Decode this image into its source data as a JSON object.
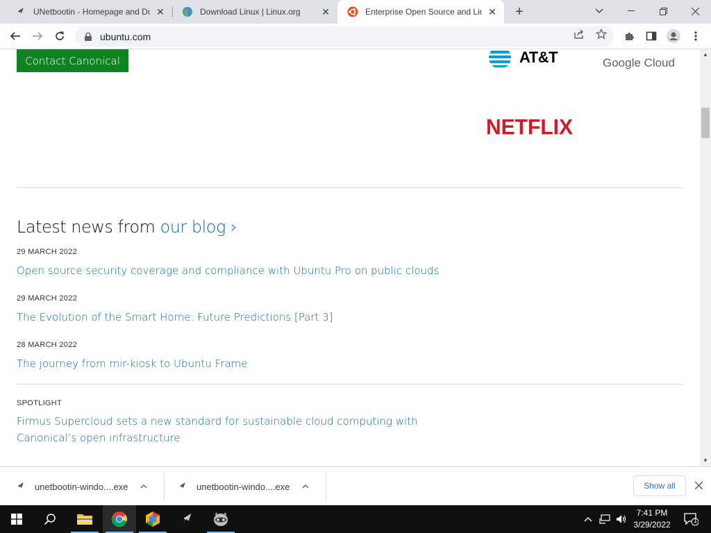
{
  "browser": {
    "tabs": [
      {
        "title": "UNetbootin - Homepage and Do",
        "favicon": "unetbootin-icon",
        "active": false
      },
      {
        "title": "Download Linux | Linux.org",
        "favicon": "globe-icon",
        "active": false
      },
      {
        "title": "Enterprise Open Source and Linu",
        "favicon": "ubuntu-icon",
        "active": true
      }
    ],
    "new_tab": "+",
    "url": "ubuntu.com"
  },
  "page": {
    "contact_button": "Contact Canonical",
    "partner_logos": {
      "att": "AT&T",
      "google_cloud": "Google Cloud",
      "netflix": "NETFLIX"
    },
    "blog_heading_prefix": "Latest news from ",
    "blog_heading_link": "our blog ›",
    "news": [
      {
        "date": "29 MARCH 2022",
        "title": "Open source security coverage and compliance with Ubuntu Pro on public clouds"
      },
      {
        "date": "29 MARCH 2022",
        "title": "The Evolution of the Smart Home: Future Predictions [Part 3]"
      },
      {
        "date": "28 MARCH 2022",
        "title": "The journey from mir-kiosk to Ubuntu Frame"
      }
    ],
    "spotlight": {
      "label": "SPOTLIGHT",
      "title": "Firmus Supercloud sets a new standard for sustainable cloud computing with Canonical’s open infrastructure"
    }
  },
  "downloads": {
    "items": [
      {
        "name": "unetbootin-windo....exe"
      },
      {
        "name": "unetbootin-windo....exe"
      }
    ],
    "show_all": "Show all"
  },
  "taskbar": {
    "time": "7:41 PM",
    "date": "3/29/2022",
    "notification_count": "1"
  }
}
